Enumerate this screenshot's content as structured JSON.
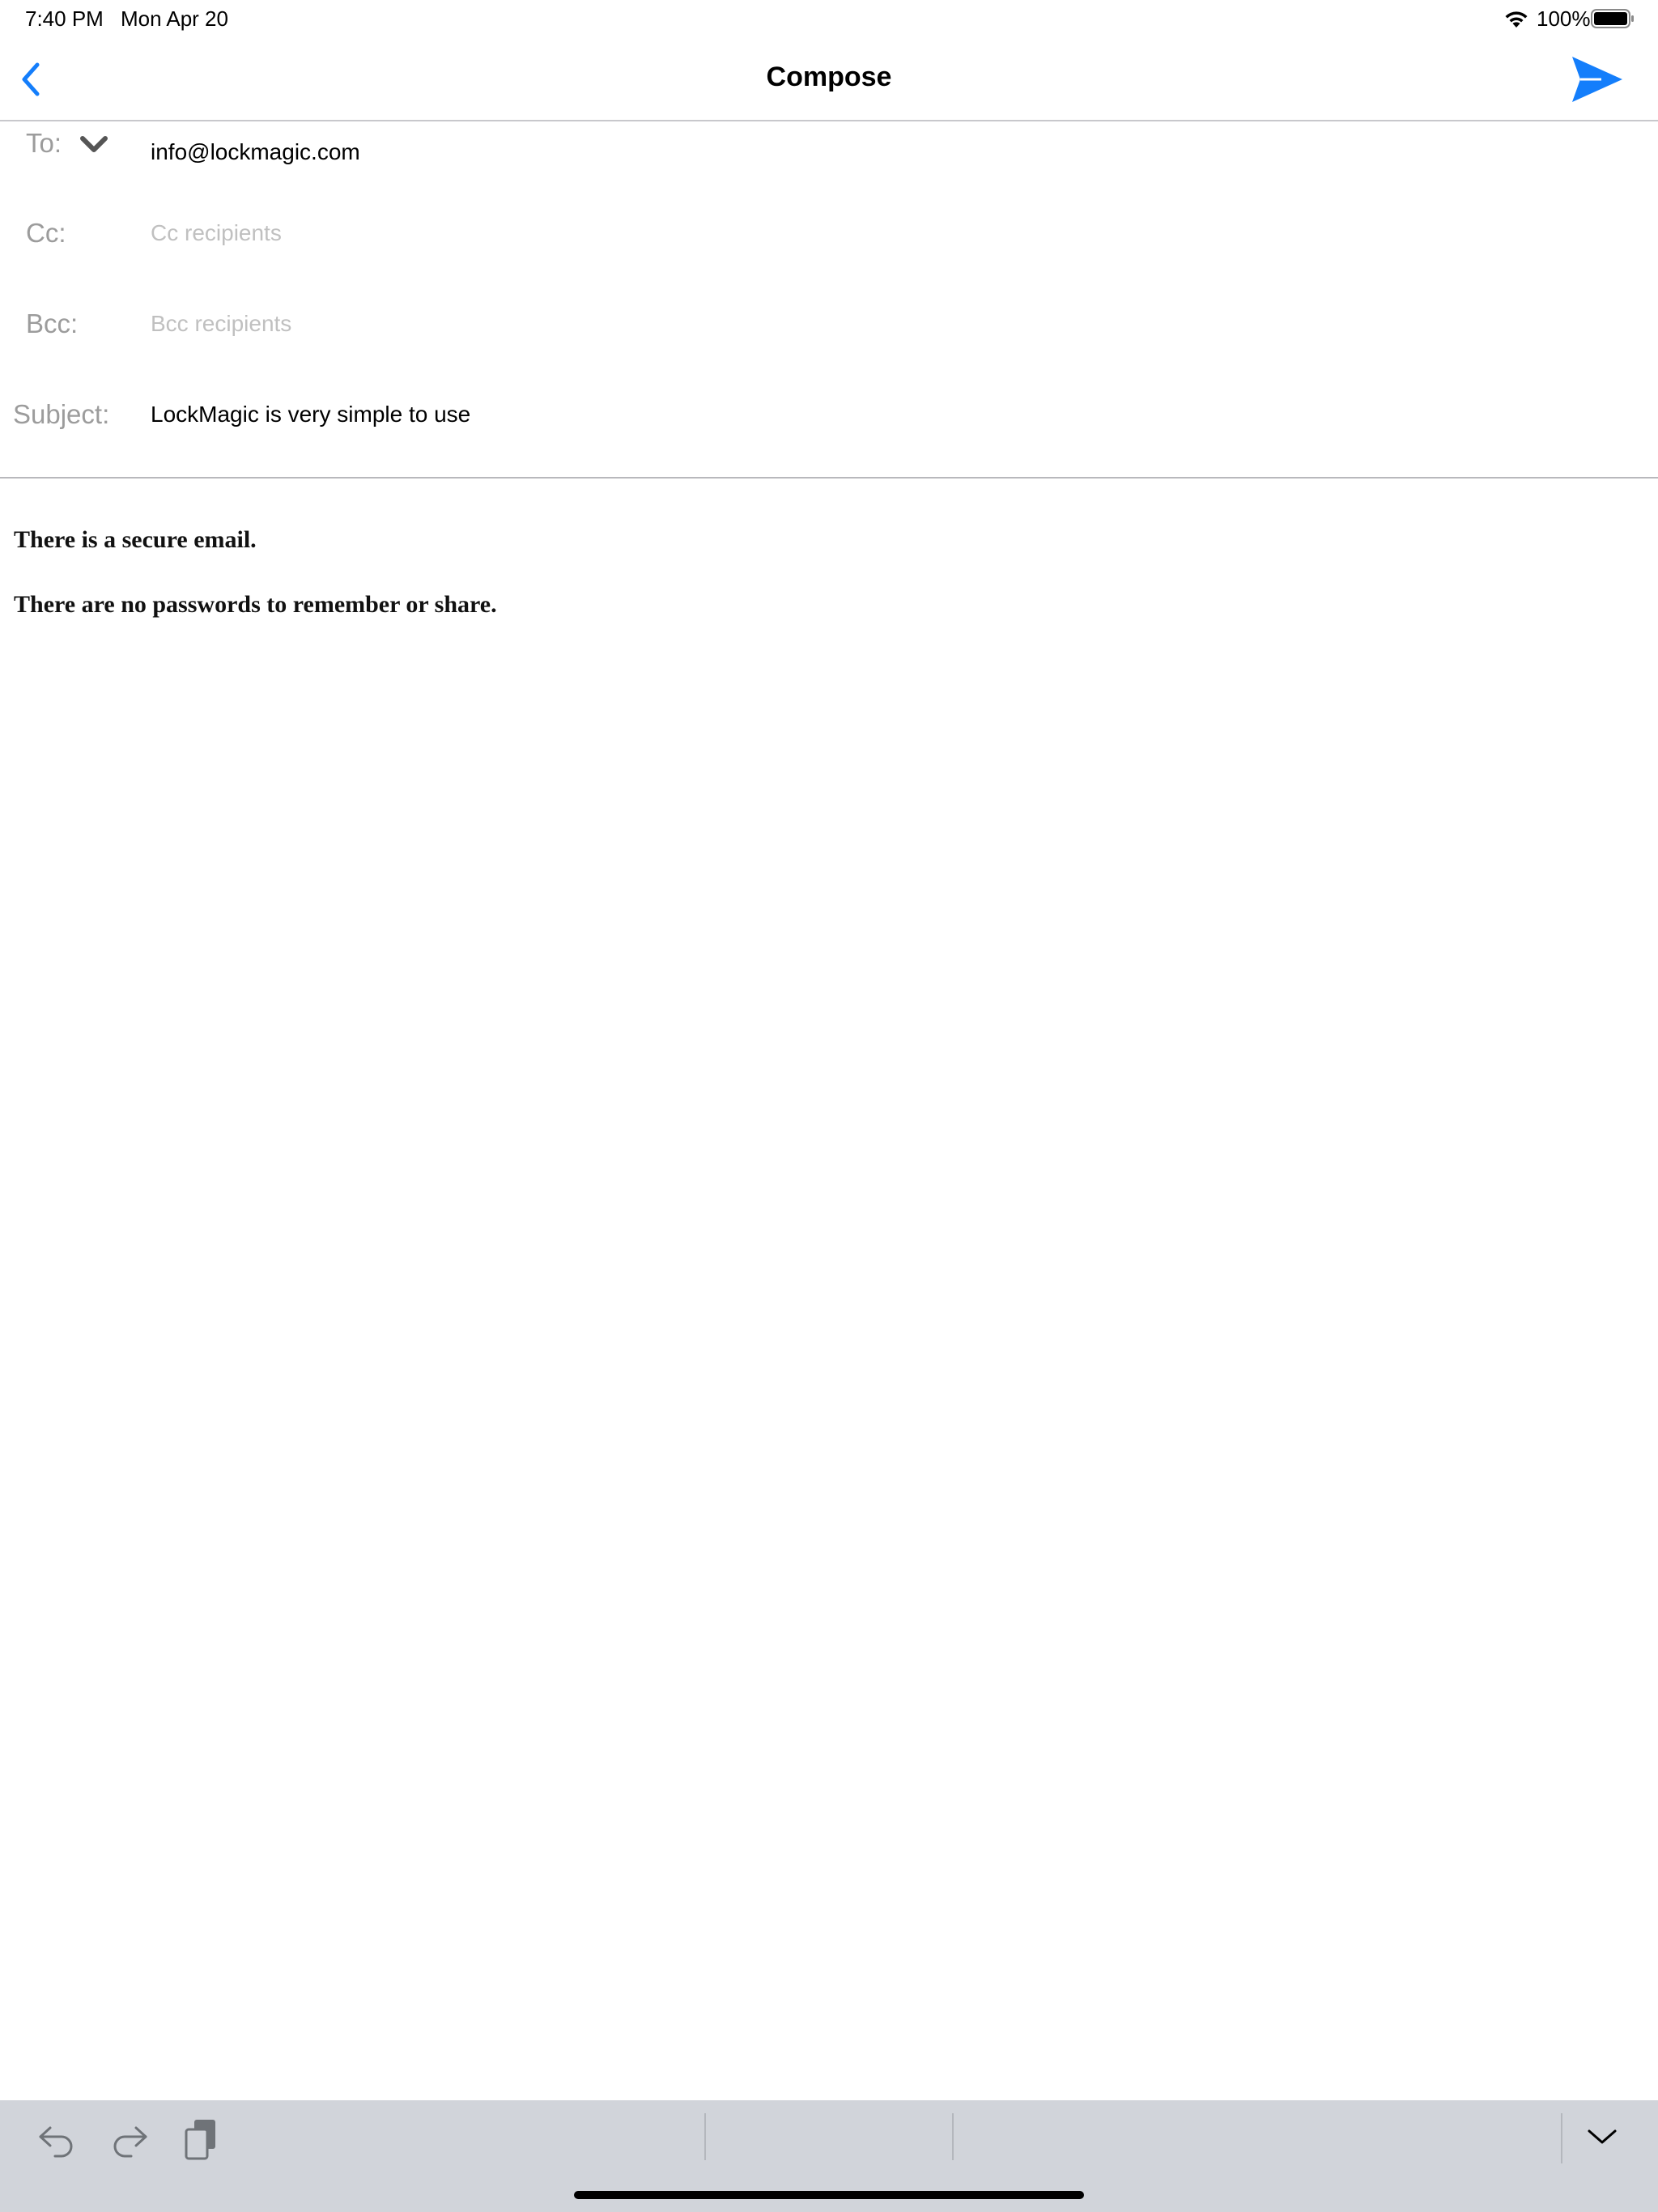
{
  "status_bar": {
    "time": "7:40 PM",
    "date": "Mon Apr 20",
    "battery_percent": "100%",
    "icons": [
      "wifi-icon",
      "battery-icon"
    ]
  },
  "nav": {
    "title": "Compose",
    "back_icon": "chevron-left-icon",
    "send_icon": "paper-plane-send-icon",
    "accent_color": "#147efb"
  },
  "fields": {
    "to": {
      "label": "To:",
      "value": "info@lockmagic.com"
    },
    "cc": {
      "label": "Cc:",
      "value": "",
      "placeholder": "Cc recipients"
    },
    "bcc": {
      "label": "Bcc:",
      "value": "",
      "placeholder": "Bcc recipients"
    },
    "subject": {
      "label": "Subject:",
      "value": "LockMagic is very simple to use"
    }
  },
  "body": {
    "lines": [
      "There is a secure email.",
      "There are no passwords to remember or share."
    ]
  },
  "accessory_bar": {
    "icons": [
      "undo-icon",
      "redo-icon",
      "paste-icon",
      "dismiss-keyboard-chevron-icon"
    ]
  }
}
